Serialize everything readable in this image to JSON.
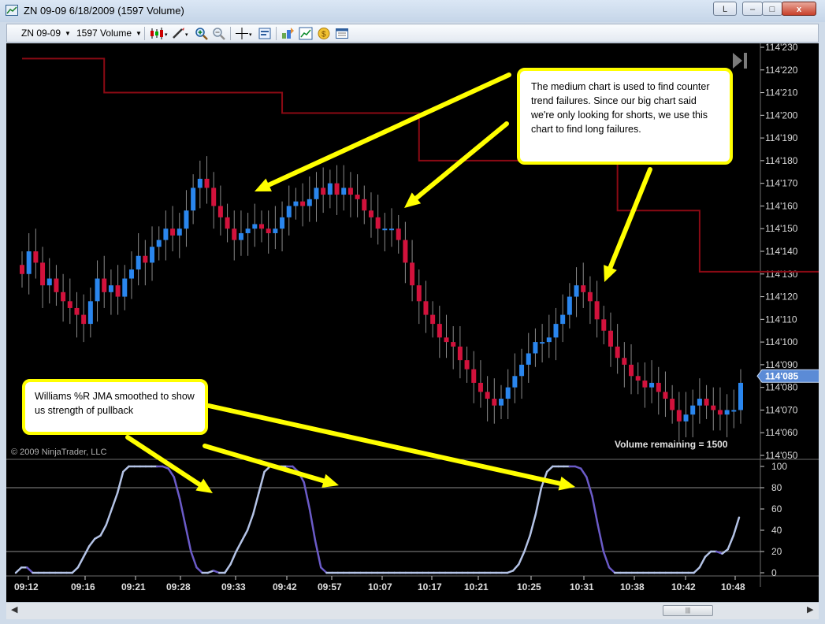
{
  "window": {
    "title": "ZN 09-09  6/18/2009 (1597 Volume)",
    "buttons": {
      "minimize": "–",
      "maximize": "□",
      "close": "x"
    },
    "corner_button": "L"
  },
  "toolbar": {
    "instrument": "ZN 09-09",
    "interval": "1597 Volume",
    "icons": [
      "candlestick-style-icon",
      "draw-pen-icon",
      "zoom-in-icon",
      "zoom-out-icon",
      "crosshair-icon",
      "properties-icon",
      "strategies-icon",
      "indicators-icon",
      "orders-icon",
      "data-box-icon"
    ]
  },
  "chart": {
    "copyright": "© 2009 NinjaTrader, LLC",
    "volume_remaining": "Volume remaining = 1500",
    "current_price": "114'085",
    "price_ticks": [
      "114'230",
      "114'220",
      "114'210",
      "114'200",
      "114'190",
      "114'180",
      "114'170",
      "114'160",
      "114'150",
      "114'140",
      "114'130",
      "114'120",
      "114'110",
      "114'100",
      "114'090",
      "114'080",
      "114'070",
      "114'060",
      "114'050"
    ],
    "indicator_ticks": [
      "100",
      "80",
      "60",
      "40",
      "20",
      "0"
    ],
    "time_ticks": [
      "09:12",
      "09:16",
      "09:21",
      "09:28",
      "09:33",
      "09:42",
      "09:57",
      "10:07",
      "10:17",
      "10:21",
      "10:25",
      "10:31",
      "10:38",
      "10:42",
      "10:48"
    ],
    "colors": {
      "up": "#2a86ee",
      "down": "#d2123c",
      "trend_line": "#8b0a14",
      "indicator_light": "#b4c3e6",
      "indicator_dark": "#6b5bc8",
      "arrow": "#ffff00"
    }
  },
  "chart_data": {
    "type": "candlestick",
    "x_axis": {
      "ticks": [
        "09:12",
        "09:16",
        "09:21",
        "09:28",
        "09:33",
        "09:42",
        "09:57",
        "10:07",
        "10:17",
        "10:21",
        "10:25",
        "10:31",
        "10:38",
        "10:42",
        "10:48"
      ]
    },
    "y_axis": {
      "unit": "price in 32nds",
      "ylim": [
        114.05,
        114.23
      ]
    },
    "closes": [
      114.13,
      114.14,
      114.135,
      114.125,
      114.128,
      114.122,
      114.118,
      114.115,
      114.112,
      114.108,
      114.118,
      114.128,
      114.122,
      114.125,
      114.12,
      114.128,
      114.132,
      114.138,
      114.135,
      114.142,
      114.145,
      114.15,
      114.147,
      114.15,
      114.158,
      114.168,
      114.172,
      114.168,
      114.16,
      114.155,
      114.15,
      114.145,
      114.148,
      114.15,
      114.152,
      114.15,
      114.148,
      114.15,
      114.155,
      114.16,
      114.162,
      114.16,
      114.163,
      114.168,
      114.165,
      114.17,
      114.165,
      114.168,
      114.165,
      114.163,
      114.158,
      114.155,
      114.15,
      114.15,
      114.15,
      114.145,
      114.135,
      114.125,
      114.118,
      114.112,
      114.108,
      114.102,
      114.1,
      114.098,
      114.092,
      114.088,
      114.082,
      114.078,
      114.075,
      114.072,
      114.075,
      114.08,
      114.085,
      114.09,
      114.095,
      114.1,
      114.1,
      114.102,
      114.108,
      114.112,
      114.12,
      114.125,
      114.122,
      114.118,
      114.11,
      114.105,
      114.098,
      114.093,
      114.09,
      114.085,
      114.083,
      114.08,
      114.082,
      114.078,
      114.075,
      114.07,
      114.065,
      114.068,
      114.072,
      114.075,
      114.072,
      114.07,
      114.068,
      114.07,
      114.07,
      114.082
    ],
    "trend_line": [
      {
        "from_bar": 0,
        "to_bar": 12,
        "value": 114.225
      },
      {
        "from_bar": 12,
        "to_bar": 38,
        "value": 114.21
      },
      {
        "from_bar": 38,
        "to_bar": 58,
        "value": 114.201
      },
      {
        "from_bar": 58,
        "to_bar": 87,
        "value": 114.18
      },
      {
        "from_bar": 87,
        "to_bar": 99,
        "value": 114.158
      },
      {
        "from_bar": 99,
        "to_bar": 128,
        "value": 114.131
      },
      {
        "from_bar": 128,
        "to_bar": 135,
        "value": 114.122
      }
    ],
    "indicator": {
      "name": "Williams %R JMA",
      "ylim": [
        0,
        100
      ],
      "values": [
        0,
        5,
        5,
        0,
        0,
        0,
        0,
        0,
        0,
        0,
        0,
        5,
        15,
        25,
        32,
        35,
        45,
        60,
        75,
        95,
        100,
        100,
        100,
        100,
        100,
        100,
        100,
        98,
        90,
        70,
        45,
        20,
        5,
        0,
        0,
        2,
        0,
        0,
        8,
        20,
        30,
        40,
        55,
        75,
        95,
        100,
        100,
        100,
        100,
        100,
        95,
        85,
        60,
        30,
        5,
        0,
        0,
        0,
        0,
        0,
        0,
        0,
        0,
        0,
        0,
        0,
        0,
        0,
        0,
        0,
        0,
        0,
        0,
        0,
        0,
        0,
        0,
        0,
        0,
        0,
        0,
        0,
        0,
        0,
        0,
        0,
        0,
        0,
        2,
        8,
        20,
        35,
        55,
        80,
        95,
        100,
        100,
        100,
        100,
        100,
        98,
        90,
        72,
        45,
        20,
        5,
        0,
        0,
        0,
        0,
        0,
        0,
        0,
        0,
        0,
        0,
        0,
        0,
        0,
        0,
        0,
        5,
        15,
        20,
        20,
        18,
        22,
        35,
        52
      ]
    }
  },
  "annotations": {
    "medium_chart_note": "The medium chart is used to find counter trend failures.  Since our big chart said we're only looking for shorts, we use this chart to find long failures.",
    "williams_note": "Williams %R JMA smoothed to show us strength of pullback"
  }
}
